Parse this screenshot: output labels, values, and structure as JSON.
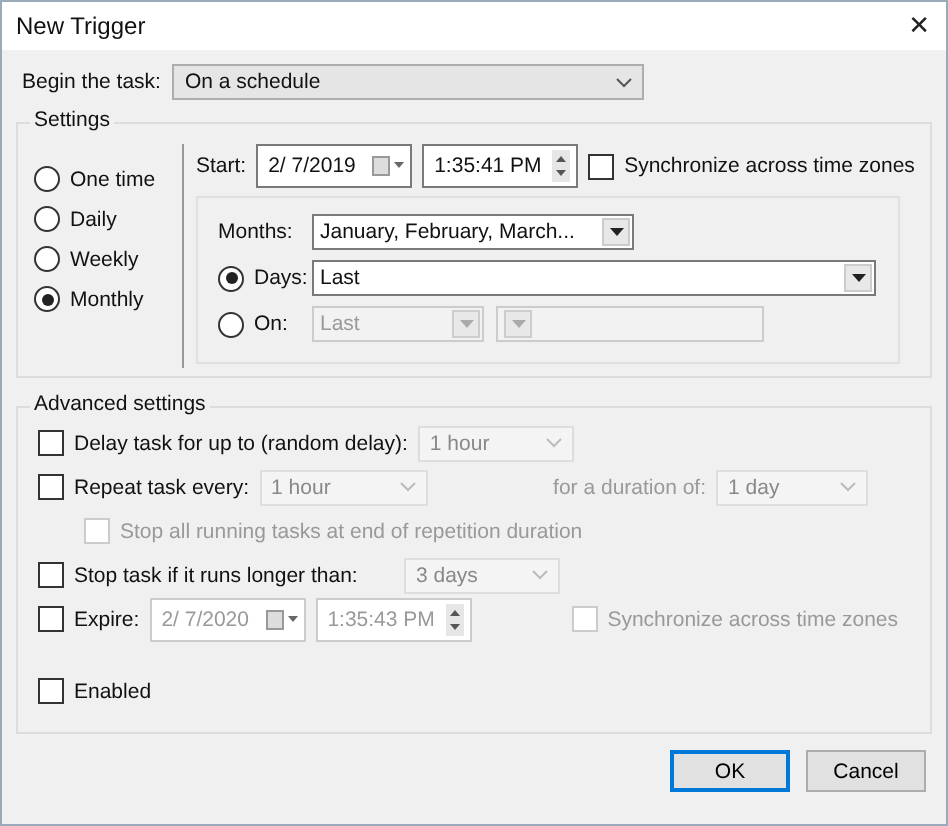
{
  "window": {
    "title": "New Trigger",
    "close": "✕"
  },
  "begin": {
    "label": "Begin the task:",
    "value": "On a schedule"
  },
  "settings": {
    "title": "Settings",
    "schedules": [
      {
        "label": "One time",
        "selected": false
      },
      {
        "label": "Daily",
        "selected": false
      },
      {
        "label": "Weekly",
        "selected": false
      },
      {
        "label": "Monthly",
        "selected": true
      }
    ],
    "start": {
      "label": "Start:",
      "date": "2/ 7/2019",
      "time": "1:35:41 PM",
      "sync": {
        "label": "Synchronize across time zones",
        "checked": false
      }
    },
    "months": {
      "label": "Months:",
      "value": "January, February, March..."
    },
    "days": {
      "label": "Days:",
      "selected": true,
      "value": "Last"
    },
    "on": {
      "label": "On:",
      "selected": false,
      "value": "Last"
    }
  },
  "advanced": {
    "title": "Advanced settings",
    "delay": {
      "label": "Delay task for up to (random delay):",
      "checked": false,
      "value": "1 hour"
    },
    "repeat": {
      "label": "Repeat task every:",
      "checked": false,
      "value": "1 hour",
      "duration_label": "for a duration of:",
      "duration_value": "1 day"
    },
    "stop_all": {
      "label": "Stop all running tasks at end of repetition duration",
      "checked": false
    },
    "stop_long": {
      "label": "Stop task if it runs longer than:",
      "checked": false,
      "value": "3 days"
    },
    "expire": {
      "label": "Expire:",
      "checked": false,
      "date": "2/ 7/2020",
      "time": "1:35:43 PM",
      "sync": {
        "label": "Synchronize across time zones",
        "checked": false
      }
    },
    "enabled": {
      "label": "Enabled",
      "checked": false
    }
  },
  "buttons": [
    {
      "label": "OK",
      "default": true
    },
    {
      "label": "Cancel",
      "default": false
    }
  ]
}
